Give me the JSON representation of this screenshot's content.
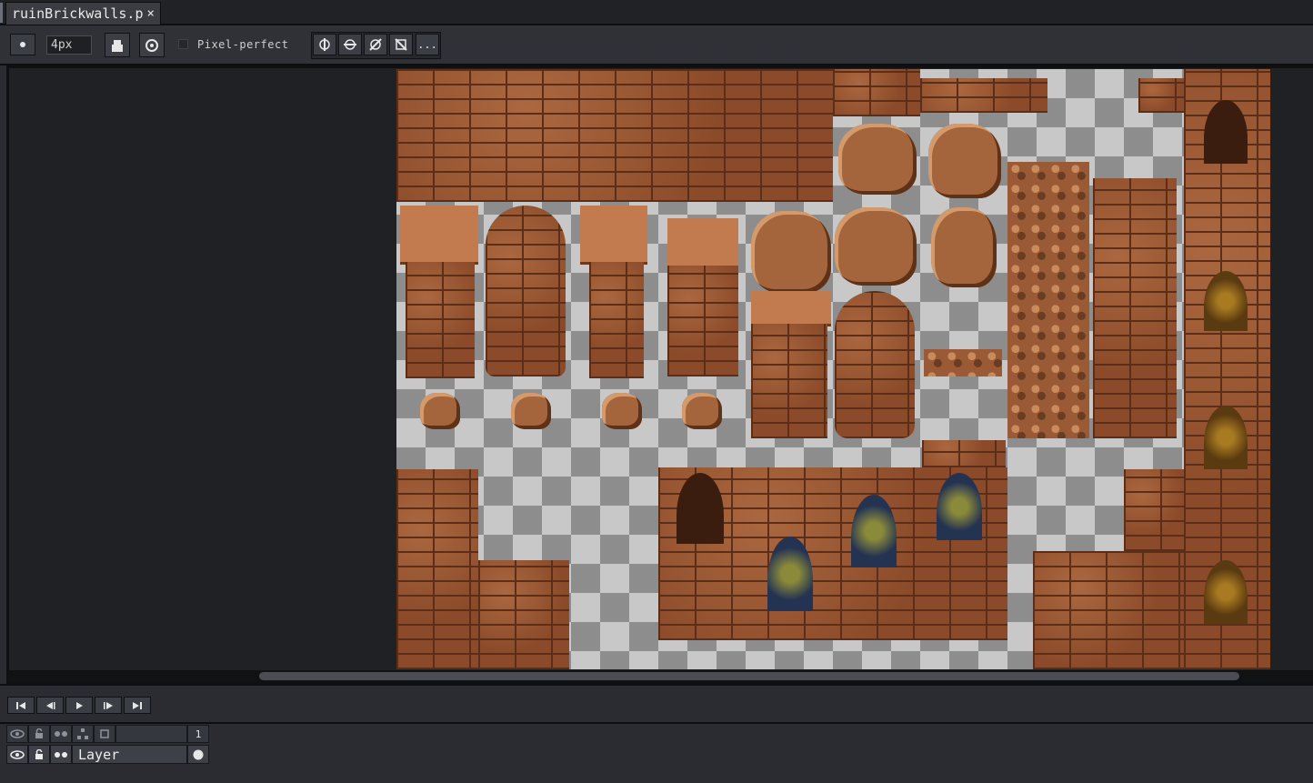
{
  "tab": {
    "filename": "ruinBrickwalls.p",
    "close_glyph": "×"
  },
  "toolbar": {
    "brush_size": "4px",
    "pixel_perfect_label": "Pixel-perfect",
    "pixel_perfect_checked": false,
    "more_label": "..."
  },
  "timeline": {
    "frame_header": "1",
    "layer_name": "Layer"
  }
}
